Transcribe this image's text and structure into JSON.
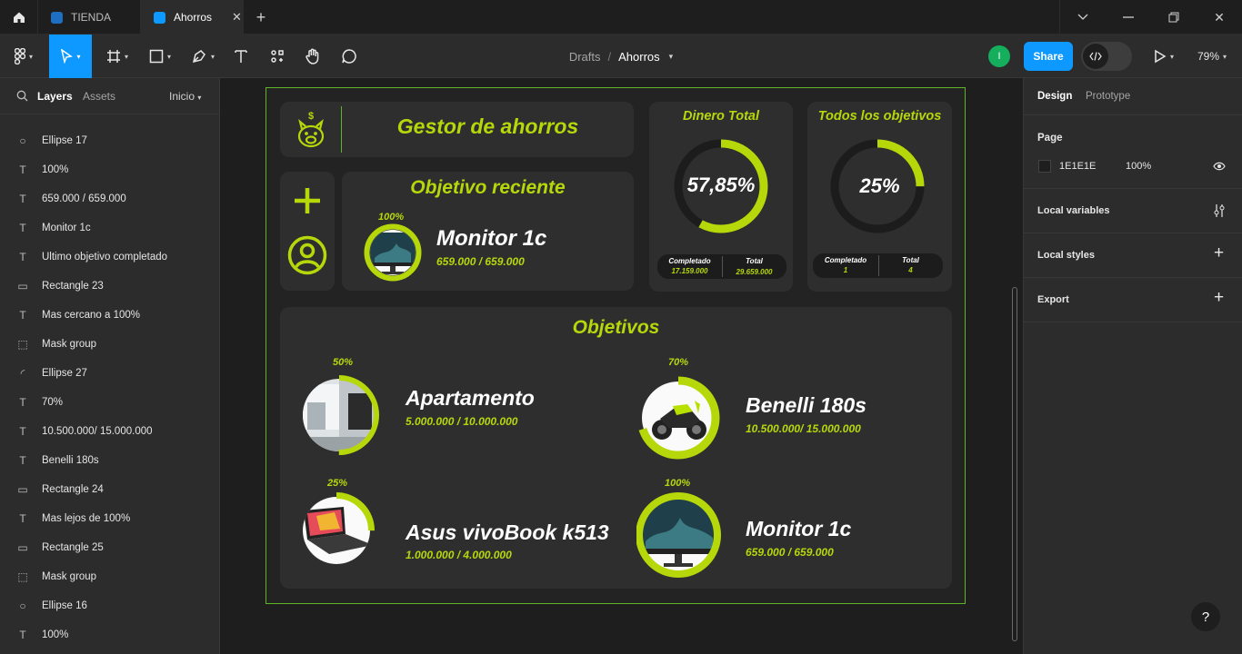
{
  "tabs": [
    {
      "label": "TIENDA"
    },
    {
      "label": "Ahorros"
    }
  ],
  "toolbar": {
    "breadcrumb_root": "Drafts",
    "breadcrumb_sep": "/",
    "file_name": "Ahorros",
    "share_label": "Share",
    "avatar_initial": "I",
    "zoom": "79%"
  },
  "left": {
    "tab_layers": "Layers",
    "tab_assets": "Assets",
    "page_selector": "Inicio",
    "layers": [
      {
        "icon": "ellipse",
        "name": "Ellipse 17"
      },
      {
        "icon": "text",
        "name": "100%"
      },
      {
        "icon": "text",
        "name": "659.000 / 659.000"
      },
      {
        "icon": "text",
        "name": "Monitor 1c"
      },
      {
        "icon": "text",
        "name": "Ultimo objetivo completado"
      },
      {
        "icon": "rect",
        "name": "Rectangle 23"
      },
      {
        "icon": "text",
        "name": "Mas cercano a 100%"
      },
      {
        "icon": "mask",
        "name": "Mask group"
      },
      {
        "icon": "arc",
        "name": "Ellipse 27"
      },
      {
        "icon": "text",
        "name": "70%"
      },
      {
        "icon": "text",
        "name": "10.500.000/ 15.000.000"
      },
      {
        "icon": "text",
        "name": "Benelli 180s"
      },
      {
        "icon": "rect",
        "name": "Rectangle 24"
      },
      {
        "icon": "text",
        "name": "Mas lejos de 100%"
      },
      {
        "icon": "rect",
        "name": "Rectangle 25"
      },
      {
        "icon": "mask",
        "name": "Mask group"
      },
      {
        "icon": "ellipse",
        "name": "Ellipse 16"
      },
      {
        "icon": "text",
        "name": "100%"
      }
    ]
  },
  "right": {
    "tab_design": "Design",
    "tab_prototype": "Prototype",
    "page_title": "Page",
    "page_color": "1E1E1E",
    "page_opacity": "100%",
    "local_variables": "Local variables",
    "local_styles": "Local styles",
    "export": "Export",
    "help": "?"
  },
  "design": {
    "title": "Gestor de ahorros",
    "recent": {
      "heading": "Objetivo reciente",
      "pct": "100%",
      "name": "Monitor 1c",
      "amount": "659.000 / 659.000",
      "progress": 1.0
    },
    "money": {
      "heading": "Dinero Total",
      "value": "57,85%",
      "progress": 0.5785,
      "completed_label": "Completado",
      "completed_value": "17.159.000",
      "total_label": "Total",
      "total_value": "29.659.000"
    },
    "goals_all": {
      "heading": "Todos los objetivos",
      "value": "25%",
      "progress": 0.25,
      "completed_label": "Completado",
      "completed_value": "1",
      "total_label": "Total",
      "total_value": "4"
    },
    "objectives_heading": "Objetivos",
    "objectives": [
      {
        "pct": "50%",
        "name": "Apartamento",
        "amount": "5.000.000 / 10.000.000",
        "progress": 0.5
      },
      {
        "pct": "70%",
        "name": "Benelli 180s",
        "amount": "10.500.000/ 15.000.000",
        "progress": 0.7
      },
      {
        "pct": "25%",
        "name": "Asus vivoBook k513",
        "amount": "1.000.000 / 4.000.000",
        "progress": 0.25
      },
      {
        "pct": "100%",
        "name": "Monitor 1c",
        "amount": "659.000 / 659.000",
        "progress": 1.0
      }
    ]
  },
  "colors": {
    "accent": "#b6d80b",
    "share": "#0d99ff",
    "frame_border": "#5eb52a",
    "avatar": "#14ae5c"
  }
}
